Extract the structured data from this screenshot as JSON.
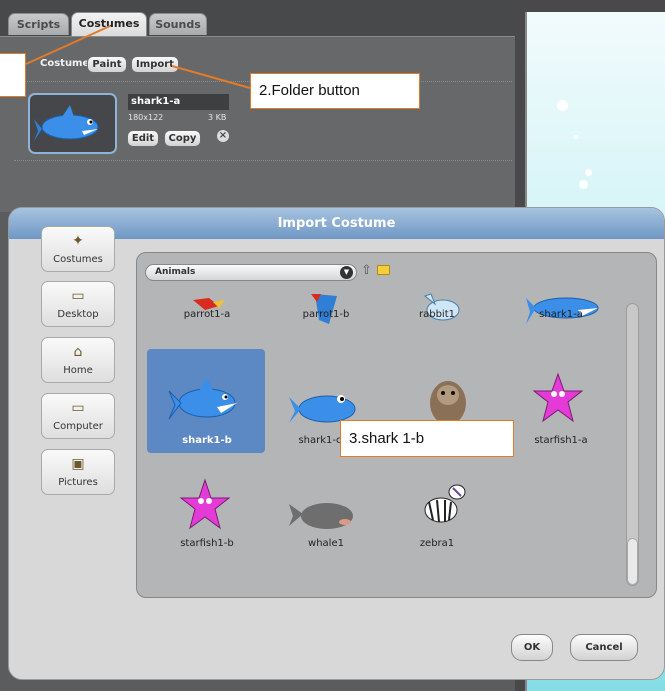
{
  "tabs": [
    {
      "label": "Scripts"
    },
    {
      "label": "Costumes"
    },
    {
      "label": "Sounds"
    }
  ],
  "costume_editor": {
    "label": "Costume:",
    "paint_label": "Paint",
    "import_label": "Import",
    "costume_name": "shark1-a",
    "dimensions": "180x122",
    "size": "3 KB",
    "edit_label": "Edit",
    "copy_label": "Copy",
    "delete_icon": "x-circle-icon"
  },
  "dialog": {
    "title": "Import Costume",
    "sidebar": [
      {
        "label": "Costumes",
        "icon": "costumes-icon"
      },
      {
        "label": "Desktop",
        "icon": "folder-icon"
      },
      {
        "label": "Home",
        "icon": "home-icon"
      },
      {
        "label": "Computer",
        "icon": "folder-icon"
      },
      {
        "label": "Pictures",
        "icon": "pictures-icon"
      }
    ],
    "folder": "Animals",
    "items": [
      {
        "label": "parrot1-a"
      },
      {
        "label": "parrot1-b"
      },
      {
        "label": "rabbit1"
      },
      {
        "label": "shark1-a"
      },
      {
        "label": "shark1-b"
      },
      {
        "label": "shark1-c"
      },
      {
        "label": "squirrel1"
      },
      {
        "label": "starfish1-a"
      },
      {
        "label": "starfish1-b"
      },
      {
        "label": "whale1"
      },
      {
        "label": "zebra1"
      }
    ],
    "ok_label": "OK",
    "cancel_label": "Cancel"
  },
  "callouts": {
    "folder_button": "2.Folder button",
    "shark": "3.shark 1-b"
  },
  "colors": {
    "callout_border": "#e27b2a",
    "selection": "#5c88c4"
  }
}
